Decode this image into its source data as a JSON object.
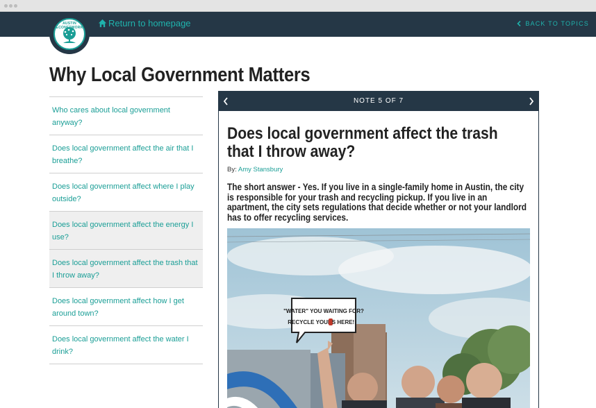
{
  "logo": {
    "text": "AUSTIN ECONETWORK"
  },
  "header": {
    "home_link": "Return to homepage",
    "back_link": "BACK TO TOPICS"
  },
  "page": {
    "title": "Why Local Government Matters"
  },
  "toc": {
    "items": [
      {
        "label": "Who cares about local government anyway?"
      },
      {
        "label": "Does local government affect the air that I breathe?"
      },
      {
        "label": "Does local government affect where I play outside?"
      },
      {
        "label": "Does local government affect the energy I use?"
      },
      {
        "label": "Does local government affect the trash that I throw away?"
      },
      {
        "label": "Does local government affect how I get around town?"
      },
      {
        "label": "Does local government affect the water I drink?"
      }
    ]
  },
  "note": {
    "counter": "NOTE 5 OF 7",
    "title": "Does local government affect the trash that I throw away?",
    "byline_prefix": "By:",
    "author": "Amy Stansbury",
    "summary": "The short answer - Yes. If you live in a single-family home in Austin, the city is responsible for your trash and recycling pickup. If you live in an apartment, the city sets regulations that decide whether or not your landlord has to offer recycling services."
  },
  "photo": {
    "sign_line1": "\"WATER\" YOU WAITING FOR?",
    "sign_line2_a": "RECYCLE YOUR",
    "sign_line2_b": "S HERE!"
  },
  "colors": {
    "navy": "#253746",
    "teal": "#1a9e96",
    "active_bg": "#efefef"
  }
}
